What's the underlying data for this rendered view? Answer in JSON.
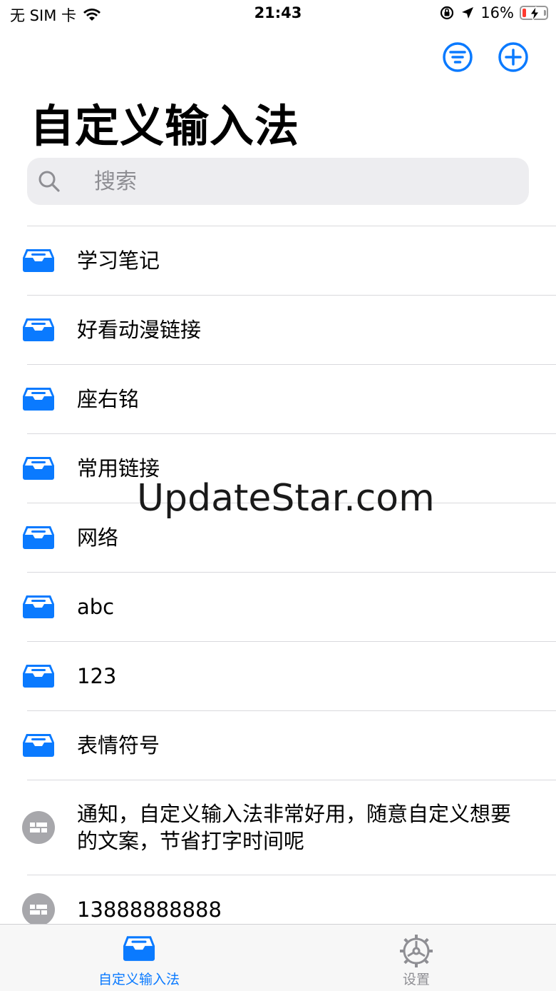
{
  "status_bar": {
    "carrier": "无 SIM 卡",
    "time": "21:43",
    "battery": "16%",
    "battery_level": 0.16,
    "icons": [
      "wifi-icon",
      "orientation-lock-icon",
      "location-arrow-icon",
      "battery-charging-icon"
    ]
  },
  "nav": {
    "title": "自定义输入法",
    "filter_icon": "filter-circle-icon",
    "add_icon": "plus-circle-icon"
  },
  "search": {
    "placeholder": "搜索"
  },
  "list": [
    {
      "label": "学习笔记",
      "icon": "tray-icon"
    },
    {
      "label": "好看动漫链接",
      "icon": "tray-icon"
    },
    {
      "label": "座右铭",
      "icon": "tray-icon"
    },
    {
      "label": "常用链接",
      "icon": "tray-icon"
    },
    {
      "label": "网络",
      "icon": "tray-icon"
    },
    {
      "label": "abc",
      "icon": "tray-icon"
    },
    {
      "label": "123",
      "icon": "tray-icon"
    },
    {
      "label": "表情符号",
      "icon": "tray-icon"
    },
    {
      "label": "通知，自定义输入法非常好用，随意自定义想要的文案，节省打字时间呢",
      "icon": "text-item-icon"
    },
    {
      "label": "13888888888",
      "icon": "text-item-icon"
    }
  ],
  "tabbar": {
    "tabs": [
      {
        "label": "自定义输入法",
        "icon": "tray-icon",
        "active": true
      },
      {
        "label": "设置",
        "icon": "gear-icon",
        "active": false
      }
    ]
  },
  "watermark": "UpdateStar.com",
  "colors": {
    "accent": "#0a7aff",
    "inactive": "#8e8e93",
    "separator": "#d9d9dd"
  }
}
